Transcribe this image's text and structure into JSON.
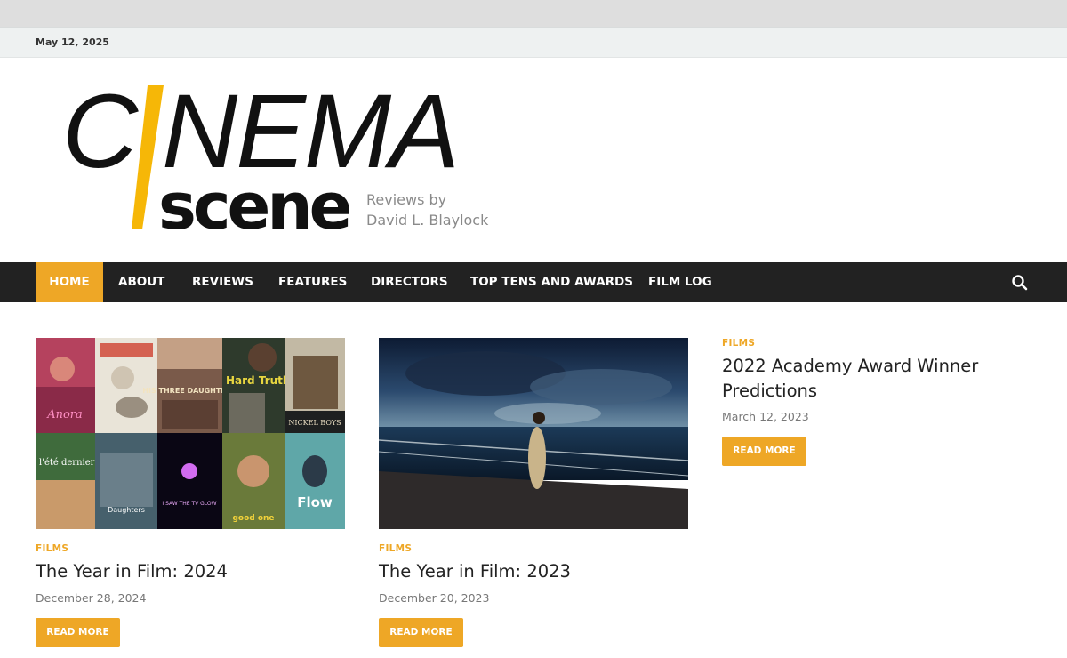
{
  "topbar": {
    "date": "May 12, 2025"
  },
  "logo": {
    "word_top": "C/NEMA",
    "word_bottom": "scene",
    "tagline_1": "Reviews by",
    "tagline_2": "David L. Blaylock",
    "accent": "#f6b707"
  },
  "nav": {
    "items": [
      {
        "label": "HOME",
        "active": true
      },
      {
        "label": "ABOUT"
      },
      {
        "label": "REVIEWS"
      },
      {
        "label": "FEATURES"
      },
      {
        "label": "DIRECTORS"
      },
      {
        "label": "TOP TENS AND AWARDS"
      },
      {
        "label": "FILM LOG"
      }
    ],
    "search_icon": "search-icon"
  },
  "posts": [
    {
      "category": "FILMS",
      "title": "The Year in Film: 2024",
      "date": "December 28, 2024",
      "button": "READ MORE",
      "image": "collage of 2024 film posters"
    },
    {
      "category": "FILMS",
      "title": "The Year in Film: 2023",
      "date": "December 20, 2023",
      "button": "READ MORE",
      "image": "woman on ship deck under stormy sky"
    },
    {
      "category": "FILMS",
      "title_line1": "2022 Academy Award Winner",
      "title_line2": "Predictions",
      "date": "March 12, 2023",
      "button": "READ MORE"
    }
  ],
  "poster_texts": {
    "p1": "Anora",
    "p3": "HIS THREE DAUGHTERS",
    "p4": "Hard Truths",
    "p5": "NICKEL BOYS",
    "p6": "l'été dernier",
    "p7": "Daughters",
    "p8": "I SAW THE TV GLOW",
    "p9": "good one",
    "p10": "Flow"
  },
  "colors": {
    "accent": "#eea726",
    "nav_bg": "#222222",
    "topbar_bg": "#eef1f1"
  }
}
